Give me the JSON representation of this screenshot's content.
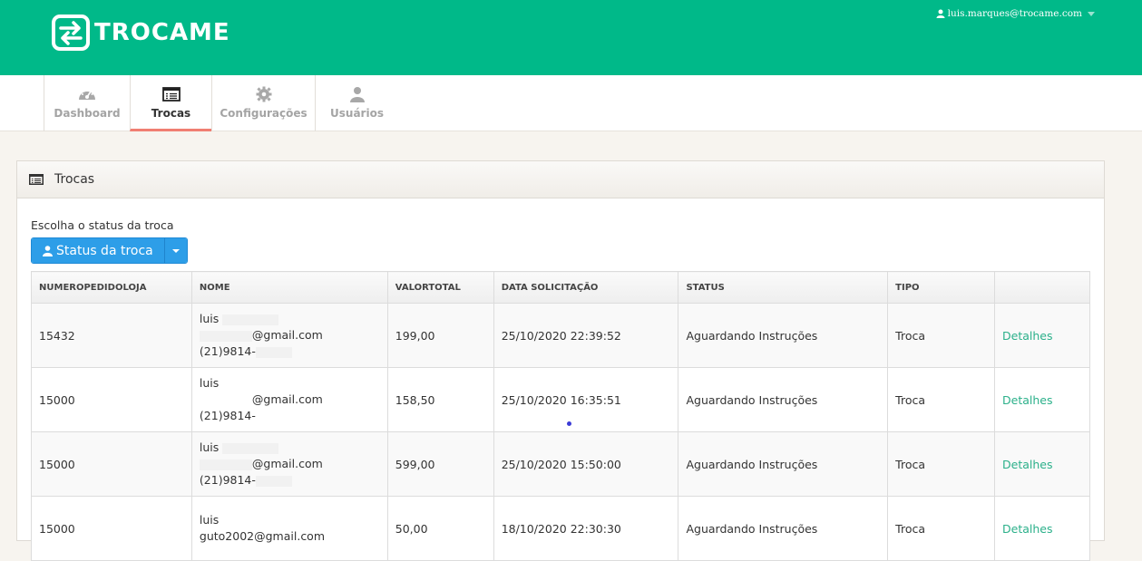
{
  "brand": {
    "name": "TROCAME",
    "color": "#00b989"
  },
  "user": {
    "email": "luis.marques@trocame.com"
  },
  "nav": {
    "items": [
      {
        "label": "Dashboard",
        "icon": "gauge-icon"
      },
      {
        "label": "Trocas",
        "icon": "list-icon",
        "active": true
      },
      {
        "label": "Configurações",
        "icon": "gear-icon"
      },
      {
        "label": "Usuários",
        "icon": "user-icon"
      }
    ]
  },
  "panel": {
    "title": "Trocas"
  },
  "filter": {
    "label": "Escolha o status da troca",
    "button_label": "Status da troca"
  },
  "table": {
    "headers": [
      "NUMEROPEDIDOLOJA",
      "NOME",
      "VALORTOTAL",
      "DATA SOLICITAÇÃO",
      "STATUS",
      "TIPO",
      ""
    ],
    "rows": [
      {
        "numero": "15432",
        "nome": "luis",
        "email": "@gmail.com",
        "phone": "(21)9814-",
        "valor": "199,00",
        "data": "25/10/2020 22:39:52",
        "status": "Aguardando Instruções",
        "tipo": "Troca",
        "acao": "Detalhes"
      },
      {
        "numero": "15000",
        "nome": "luis",
        "email": "@gmail.com",
        "phone": "(21)9814-",
        "valor": "158,50",
        "data": "25/10/2020 16:35:51",
        "status": "Aguardando Instruções",
        "tipo": "Troca",
        "acao": "Detalhes"
      },
      {
        "numero": "15000",
        "nome": "luis",
        "email": "@gmail.com",
        "phone": "(21)9814-",
        "valor": "599,00",
        "data": "25/10/2020 15:50:00",
        "status": "Aguardando Instruções",
        "tipo": "Troca",
        "acao": "Detalhes"
      },
      {
        "numero": "15000",
        "nome": "luis",
        "email": "guto2002@gmail.com",
        "phone": "",
        "valor": "50,00",
        "data": "18/10/2020 22:30:30",
        "status": "Aguardando Instruções",
        "tipo": "Troca",
        "acao": "Detalhes"
      }
    ]
  }
}
